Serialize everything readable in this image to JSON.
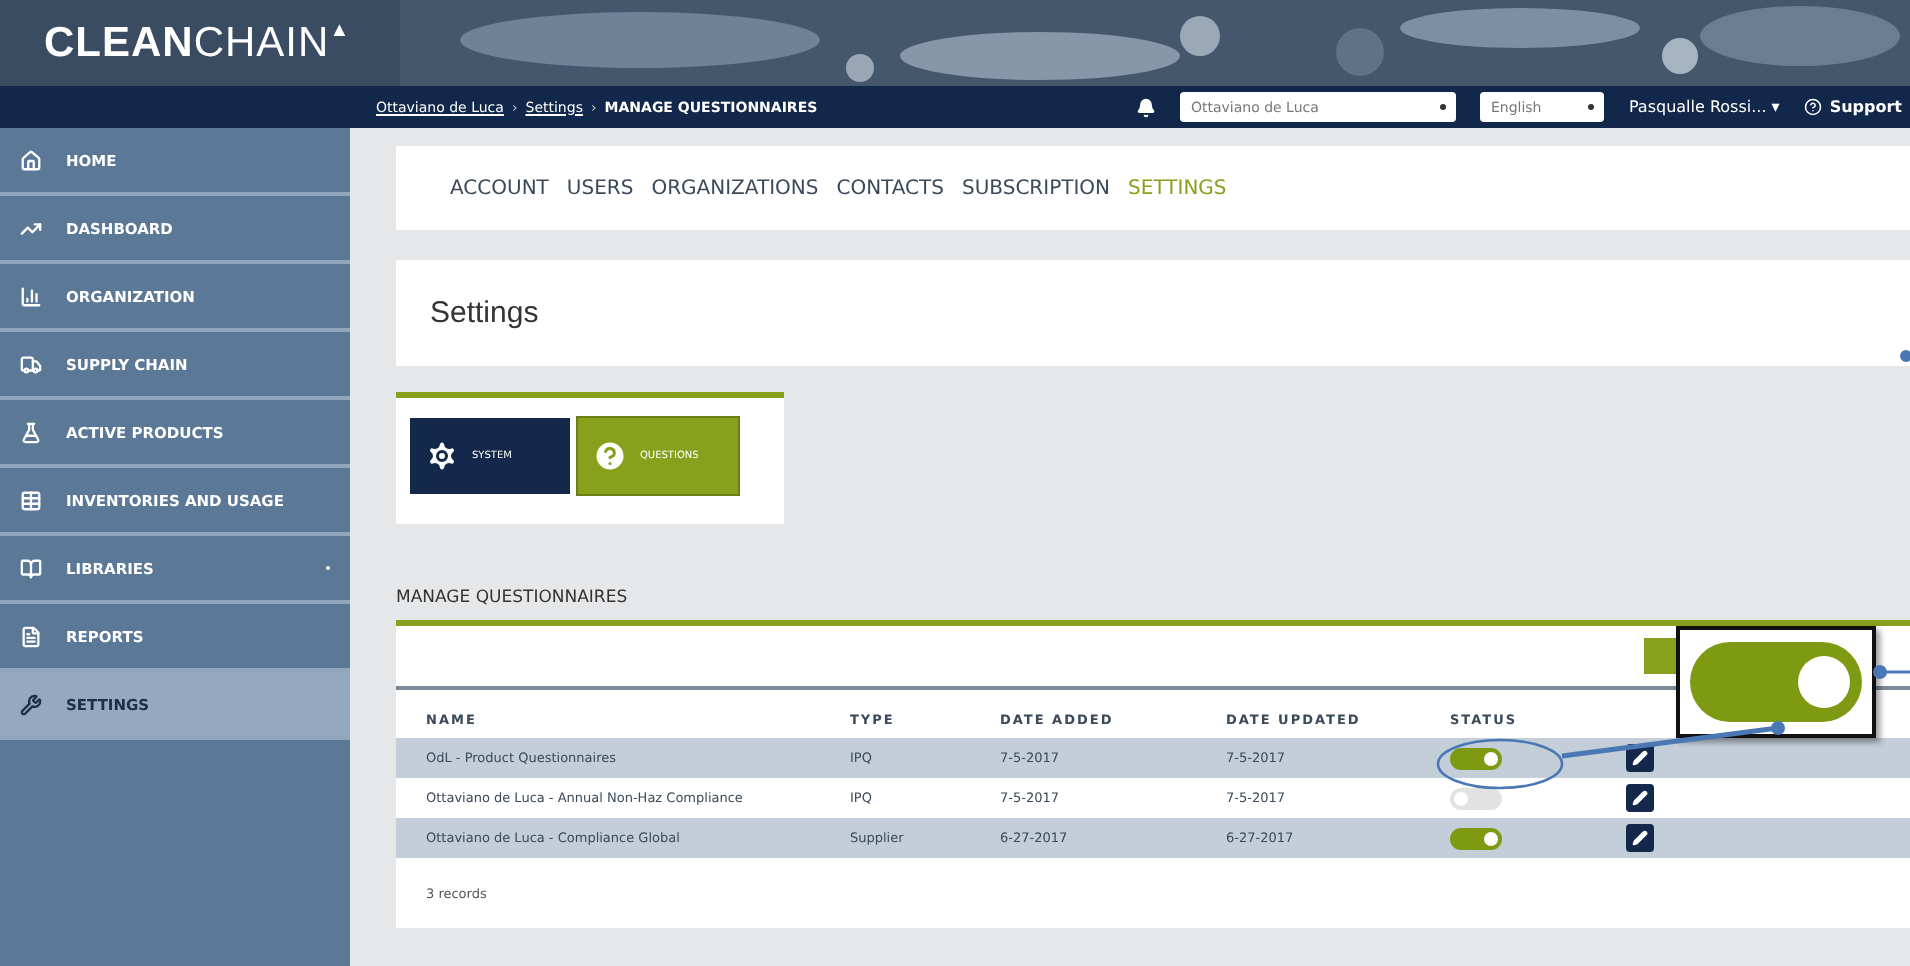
{
  "logo": {
    "bold": "CLEAN",
    "light": "CHAIN",
    "mark": "▲"
  },
  "breadcrumb": {
    "items": [
      "Ottaviano de Luca",
      "Settings",
      "MANAGE QUESTIONNAIRES"
    ],
    "separator": "›"
  },
  "header": {
    "organization_select": "Ottaviano de Luca",
    "language_select": "English",
    "user": "Pasqualle Rossi...",
    "user_caret": "▾",
    "support": "Support"
  },
  "sidebar": {
    "items": [
      {
        "label": "HOME",
        "selected": false
      },
      {
        "label": "DASHBOARD",
        "selected": false
      },
      {
        "label": "ORGANIZATION",
        "selected": false
      },
      {
        "label": "SUPPLY CHAIN",
        "selected": false
      },
      {
        "label": "ACTIVE PRODUCTS",
        "selected": false
      },
      {
        "label": "INVENTORIES AND USAGE",
        "selected": false
      },
      {
        "label": "LIBRARIES",
        "selected": false,
        "expandable": true
      },
      {
        "label": "REPORTS",
        "selected": false
      },
      {
        "label": "SETTINGS",
        "selected": true
      }
    ]
  },
  "tabs": [
    {
      "label": "ACCOUNT",
      "selected": false
    },
    {
      "label": "USERS",
      "selected": false
    },
    {
      "label": "ORGANIZATIONS",
      "selected": false
    },
    {
      "label": "CONTACTS",
      "selected": false
    },
    {
      "label": "SUBSCRIPTION",
      "selected": false
    },
    {
      "label": "SETTINGS",
      "selected": true
    }
  ],
  "page_title": "Settings",
  "tiles": [
    {
      "label": "SYSTEM",
      "kind": "gear",
      "selected": false
    },
    {
      "label": "QUESTIONS",
      "kind": "question",
      "selected": true
    }
  ],
  "section_title": "MANAGE QUESTIONNAIRES",
  "table": {
    "columns": [
      "NAME",
      "TYPE",
      "DATE ADDED",
      "DATE UPDATED",
      "STATUS"
    ],
    "rows": [
      {
        "name": "OdL - Product Questionnaires",
        "type": "IPQ",
        "date_added": "7-5-2017",
        "date_updated": "7-5-2017",
        "on": true
      },
      {
        "name": "Ottaviano de Luca - Annual Non-Haz Compliance",
        "type": "IPQ",
        "date_added": "7-5-2017",
        "date_updated": "7-5-2017",
        "on": false
      },
      {
        "name": "Ottaviano de Luca - Compliance Global",
        "type": "Supplier",
        "date_added": "6-27-2017",
        "date_updated": "6-27-2017",
        "on": true
      }
    ],
    "footer": "3 records"
  },
  "callout": {
    "on": true
  }
}
